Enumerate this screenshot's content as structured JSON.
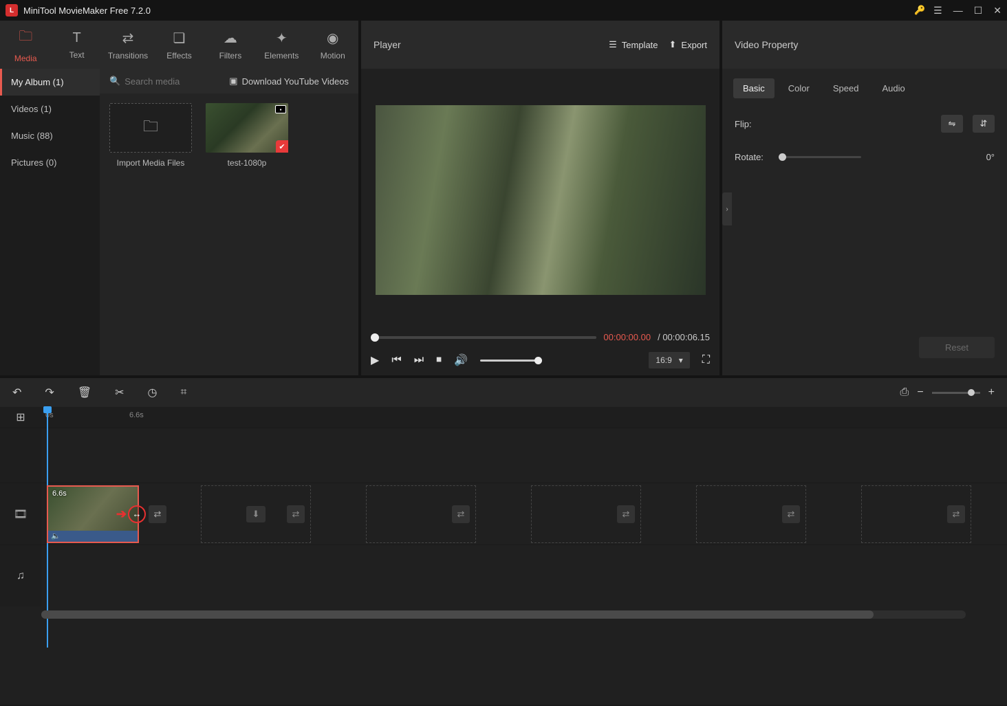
{
  "app": {
    "title": "MiniTool MovieMaker Free 7.2.0"
  },
  "top_tabs": [
    {
      "label": "Media"
    },
    {
      "label": "Text"
    },
    {
      "label": "Transitions"
    },
    {
      "label": "Effects"
    },
    {
      "label": "Filters"
    },
    {
      "label": "Elements"
    },
    {
      "label": "Motion"
    }
  ],
  "sidebar": {
    "items": [
      {
        "label": "My Album (1)"
      },
      {
        "label": "Videos (1)"
      },
      {
        "label": "Music (88)"
      },
      {
        "label": "Pictures (0)"
      }
    ]
  },
  "media_toolbar": {
    "search_placeholder": "Search media",
    "download_label": "Download YouTube Videos"
  },
  "media_grid": {
    "import_label": "Import Media Files",
    "clip1_label": "test-1080p"
  },
  "player": {
    "title": "Player",
    "template_label": "Template",
    "export_label": "Export",
    "time_current": "00:00:00.00",
    "time_total": "/ 00:00:06.15",
    "ratio": "16:9"
  },
  "right": {
    "title": "Video Property",
    "tabs": [
      {
        "label": "Basic"
      },
      {
        "label": "Color"
      },
      {
        "label": "Speed"
      },
      {
        "label": "Audio"
      }
    ],
    "flip_label": "Flip:",
    "rotate_label": "Rotate:",
    "rotate_value": "0°",
    "reset_label": "Reset"
  },
  "timeline": {
    "ruler": {
      "t0": "0s",
      "t1": "6.6s"
    },
    "clip_duration": "6.6s"
  }
}
